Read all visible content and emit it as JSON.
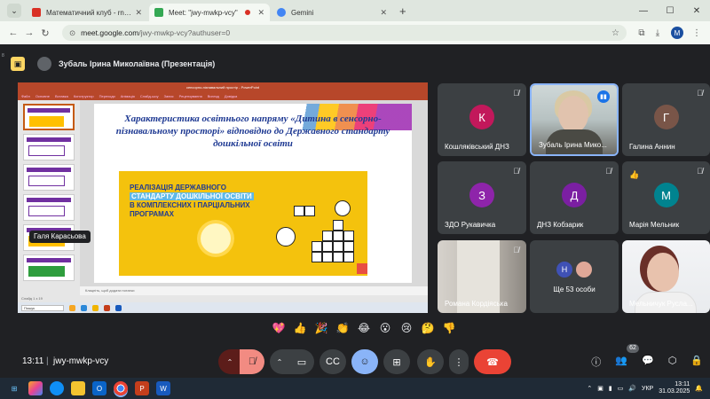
{
  "browser": {
    "tabs": [
      {
        "title": "Математичний клуб - rnelnyc",
        "fav_color": "#d93025",
        "active": false
      },
      {
        "title": "Meet: \"jwy-mwkp-vcy\"",
        "fav_color": "#34a853",
        "active": true
      },
      {
        "title": "Gemini",
        "fav_color": "#4285f4",
        "active": false
      }
    ],
    "new_tab": "+",
    "url_host": "meet.google.com",
    "url_path": "/jwy-mwkp-vcy?authuser=0",
    "profile_initial": "M",
    "side_label": "8"
  },
  "presenter": {
    "label": "Зубаль Ірина Миколаївна (Презентація)"
  },
  "powerpoint": {
    "title_bar": "сенсорно-пізнавальний простір - PowerPoint",
    "ribbon_tabs": [
      "Файл",
      "Основне",
      "Вставка",
      "Конструктор",
      "Переходи",
      "Анімація",
      "Слайд-шоу",
      "Запис",
      "Рецензування",
      "Вигляд",
      "Довідка"
    ],
    "notes": "Клацніть, щоб додати нотатки",
    "status": "Слайд 1 з 19",
    "search": "Пошук",
    "slide_heading": "Характеристика освітнього напряму «Дитина в сенсорно-пізнавальному просторі» відповідно до Державного стандарту дошкільної освіти",
    "panel_line1": "РЕАЛІЗАЦІЯ ДЕРЖАВНОГО",
    "panel_line2": "СТАНДАРТУ ДОШКІЛЬНОЇ ОСВІТИ",
    "panel_line3": "В КОМПЛЕКСНИХ І ПАРЦІАЛЬНИХ ПРОГРАМАХ",
    "thumb_numbers": [
      "1",
      "2",
      "3",
      "4",
      "5",
      "6",
      "7"
    ]
  },
  "name_tooltip": "Галя Карасьова",
  "participants": [
    {
      "name": "Кошляківський ДНЗ",
      "initial": "К",
      "color": "#c2185b"
    },
    {
      "name": "Зубаль Ірина Мико...",
      "initial": "",
      "color": ""
    },
    {
      "name": "Галина Аннин",
      "initial": "Г",
      "color": "#795548"
    },
    {
      "name": "ЗДО Рукавичка",
      "initial": "З",
      "color": "#8e24aa"
    },
    {
      "name": "ДНЗ Кобзарик",
      "initial": "Д",
      "color": "#7b1fa2"
    },
    {
      "name": "Марія Мельник",
      "initial": "М",
      "color": "#00838f"
    },
    {
      "name": "Романа Кордіяська",
      "initial": "",
      "color": ""
    },
    {
      "name": "Ще 53 особи",
      "initial": "Н",
      "color": "#3f51b5"
    },
    {
      "name": "Мельничук Русла...",
      "initial": "",
      "color": ""
    }
  ],
  "reactions": [
    "💖",
    "👍",
    "🎉",
    "👏",
    "😂",
    "😮",
    "😢",
    "🤔",
    "👎"
  ],
  "bottom": {
    "time": "13:11",
    "separator": "|",
    "meeting_code": "jwy-mwkp-vcy",
    "participant_count": "62"
  },
  "taskbar": {
    "lang": "УКР",
    "time": "13:11",
    "date": "31.03.2025"
  }
}
